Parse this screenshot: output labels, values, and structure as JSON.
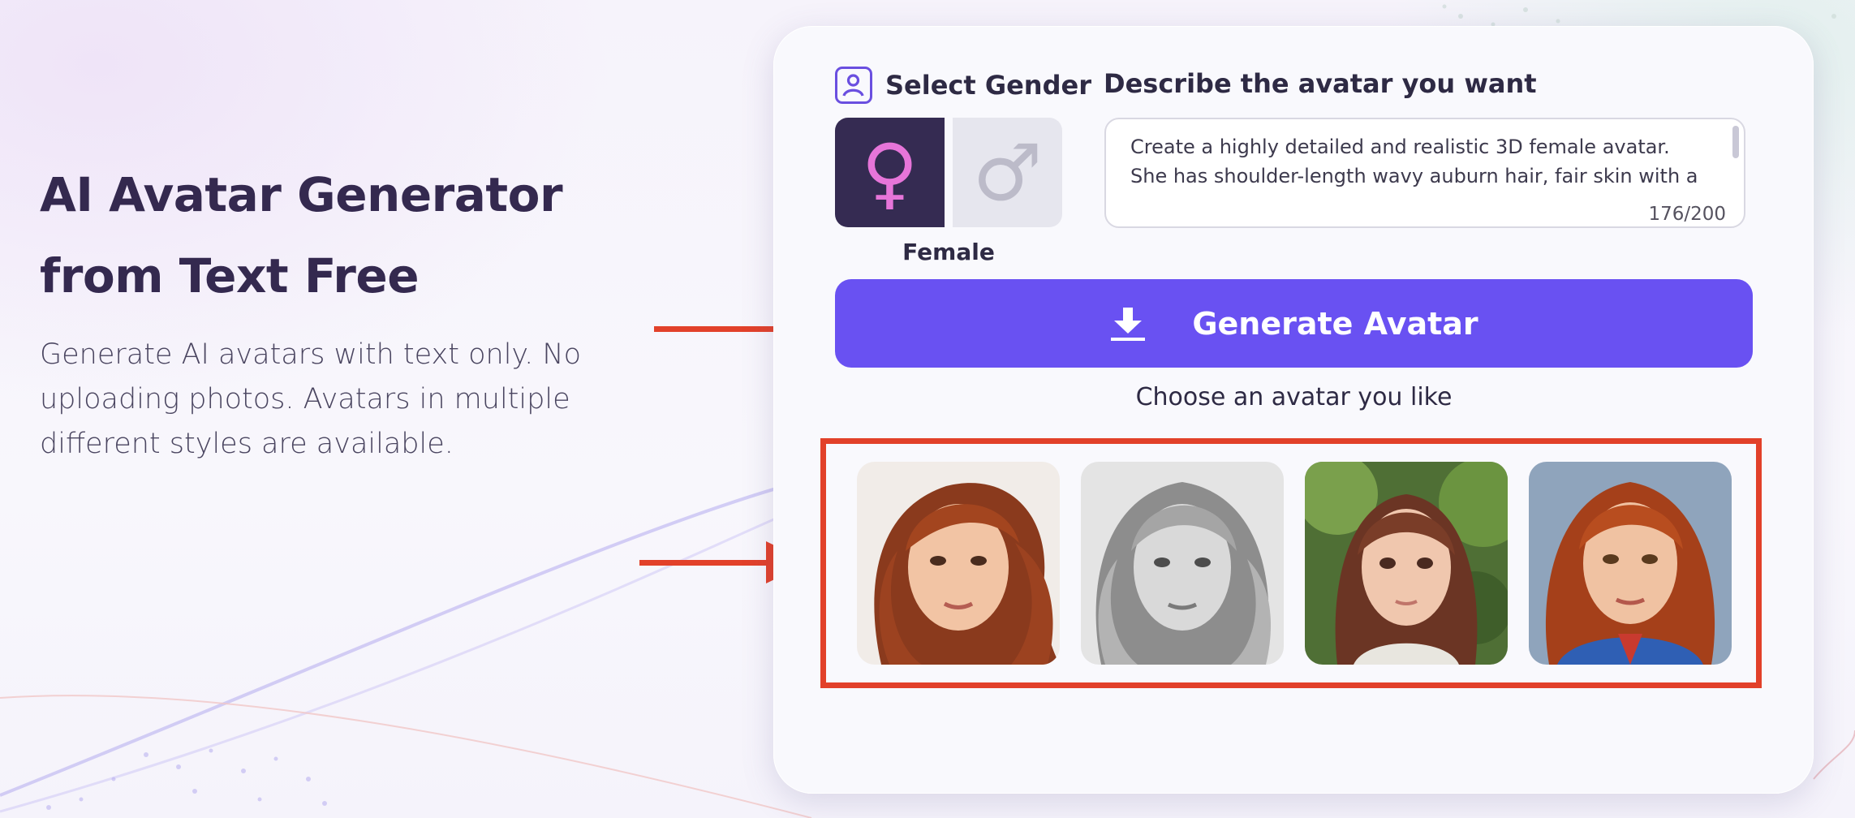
{
  "hero": {
    "title_line1": "AI Avatar Generator",
    "title_line2": "from Text Free",
    "description": "Generate AI avatars with text only. No uploading photos. Avatars in multiple different styles are available."
  },
  "gender": {
    "heading": "Select Gender",
    "icon": "user-portrait-icon",
    "options": [
      {
        "name": "female",
        "symbol": "♀",
        "selected": true
      },
      {
        "name": "male",
        "symbol": "♂",
        "selected": false
      }
    ],
    "selected_label": "Female"
  },
  "description": {
    "heading": "Describe the avatar you want",
    "value": "Create a highly detailed and realistic 3D female avatar. She has shoulder-length wavy auburn hair, fair skin with a",
    "counter": "176/200"
  },
  "generate": {
    "label": "Generate Avatar",
    "icon": "download-icon"
  },
  "results": {
    "prompt": "Choose an avatar you like",
    "avatars": [
      {
        "style": "realistic-3d"
      },
      {
        "style": "black-and-white"
      },
      {
        "style": "anime"
      },
      {
        "style": "superhero"
      }
    ]
  },
  "colors": {
    "accent": "#6951f2",
    "highlight": "#e2412a",
    "female_pink": "#e675d9",
    "dark": "#352b52"
  }
}
